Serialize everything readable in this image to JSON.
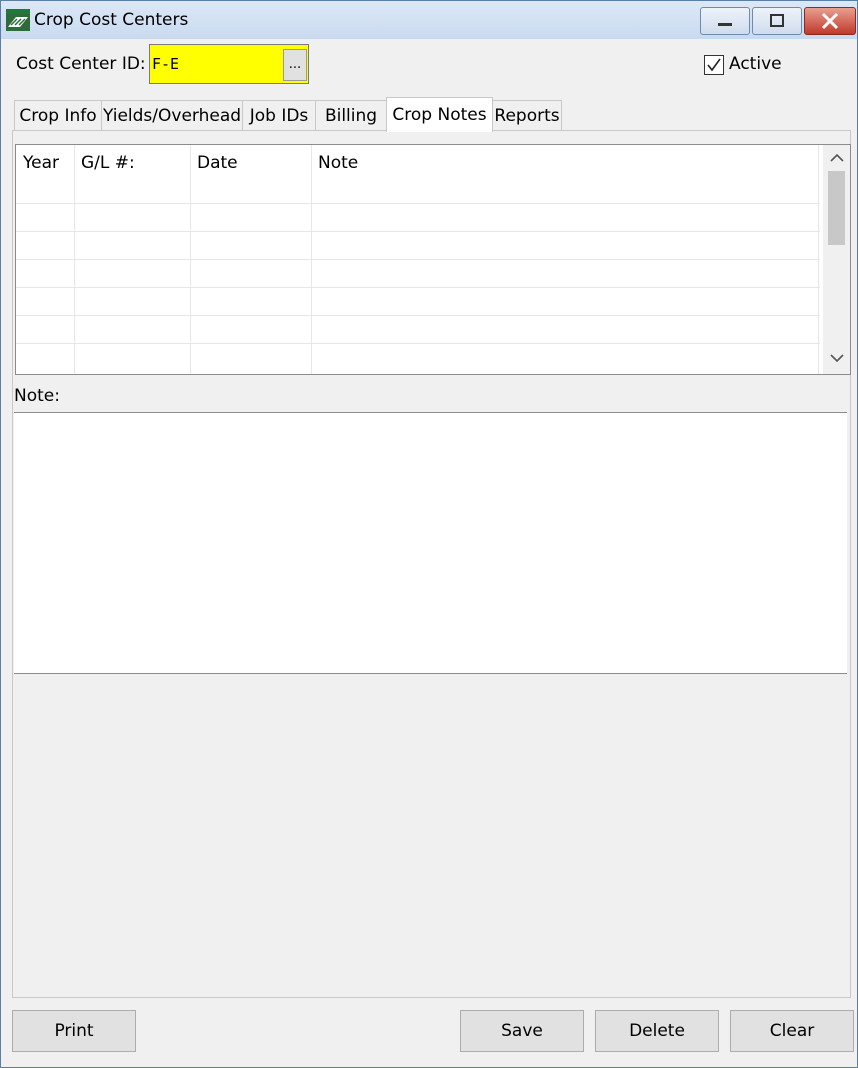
{
  "window": {
    "title": "Crop Cost Centers",
    "icon": "app-icon"
  },
  "header": {
    "cost_center_label": "Cost Center  ID:",
    "cost_center_value": "F-E",
    "browse_label": "...",
    "active_label": "Active",
    "active_checked": true
  },
  "tabs": [
    {
      "label": "Crop Info",
      "active": false
    },
    {
      "label": "Yields/Overhead",
      "active": false
    },
    {
      "label": "Job IDs",
      "active": false
    },
    {
      "label": "Billing",
      "active": false
    },
    {
      "label": "Crop Notes",
      "active": true
    },
    {
      "label": "Reports",
      "active": false
    }
  ],
  "notes_grid": {
    "columns": [
      "Year",
      "G/L #:",
      "Date",
      "Note"
    ],
    "rows": []
  },
  "note_section": {
    "label": "Note:",
    "value": ""
  },
  "footer": {
    "print_label": "Print",
    "save_label": "Save",
    "delete_label": "Delete",
    "clear_label": "Clear"
  },
  "colors": {
    "id_highlight": "#ffff00",
    "close_button": "#c0392b"
  }
}
